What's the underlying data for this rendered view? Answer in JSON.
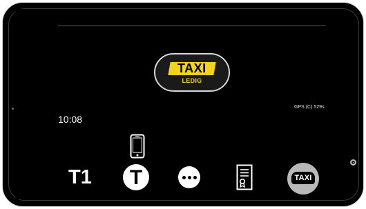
{
  "status_sign": {
    "brand_text": "TAXI",
    "status_text": "LEDIG",
    "plate_color": "#f2d21a"
  },
  "gps": {
    "text": "GPS (C) 529s"
  },
  "clock": {
    "time": "10:08"
  },
  "bottom_bar": {
    "t1_label": "T1",
    "t_button_label": "T",
    "more_icon": "more-dots-icon",
    "document_icon": "certificate-document-icon",
    "taxi_button_label": "TAXI"
  },
  "indicators": {
    "phone_icon": "smartphone-icon"
  },
  "colors": {
    "background": "#000000",
    "foreground": "#ffffff",
    "accent_yellow": "#f2d21a",
    "taxi_button_gray": "#b9b9b9"
  }
}
